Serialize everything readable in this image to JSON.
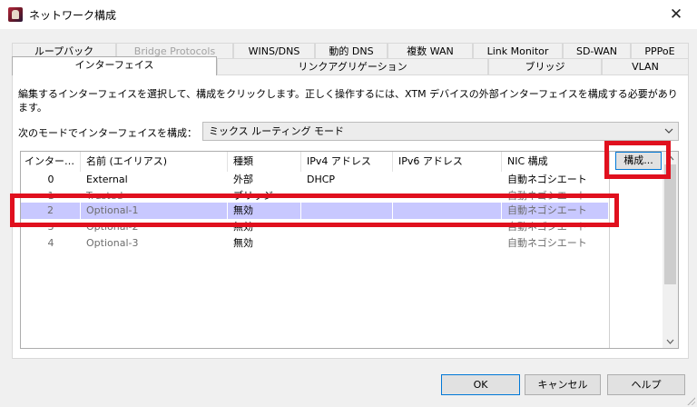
{
  "window": {
    "title": "ネットワーク構成",
    "close": "✕"
  },
  "tabs_row1": [
    {
      "label": "ループバック",
      "disabled": false
    },
    {
      "label": "Bridge Protocols",
      "disabled": true
    },
    {
      "label": "WINS/DNS",
      "disabled": false
    },
    {
      "label": "動的 DNS",
      "disabled": false
    },
    {
      "label": "複数 WAN",
      "disabled": false
    },
    {
      "label": "Link Monitor",
      "disabled": false
    },
    {
      "label": "SD-WAN",
      "disabled": false
    },
    {
      "label": "PPPoE",
      "disabled": false
    }
  ],
  "tabs_row2": [
    {
      "label": "インターフェイス",
      "active": true
    },
    {
      "label": "リンクアグリゲーション",
      "active": false
    },
    {
      "label": "ブリッジ",
      "active": false
    },
    {
      "label": "VLAN",
      "active": false
    }
  ],
  "description": "編集するインターフェイスを選択して、構成をクリックします。正しく操作するには、XTM デバイスの外部インターフェイスを構成する必要があります。",
  "mode": {
    "label": "次のモードでインターフェイスを構成：",
    "value": "ミックス ルーティング モード"
  },
  "table": {
    "columns": [
      "インター…",
      "名前 (エイリアス)",
      "種類",
      "IPv4 アドレス",
      "IPv6 アドレス",
      "NIC 構成"
    ],
    "rows": [
      {
        "index": "0",
        "name": "External",
        "type": "外部",
        "ipv4": "DHCP",
        "ipv6": "",
        "nic": "自動ネゴシエート",
        "selected": false,
        "dim": false
      },
      {
        "index": "1",
        "name": "Trusted",
        "type": "ブリッジ",
        "ipv4": "",
        "ipv6": "",
        "nic": "自動ネゴシエート",
        "selected": false,
        "dim": true
      },
      {
        "index": "2",
        "name": "Optional-1",
        "type": "無効",
        "ipv4": "",
        "ipv6": "",
        "nic": "自動ネゴシエート",
        "selected": true,
        "dim": true
      },
      {
        "index": "3",
        "name": "Optional-2",
        "type": "無効",
        "ipv4": "",
        "ipv6": "",
        "nic": "自動ネゴシエート",
        "selected": false,
        "dim": true
      },
      {
        "index": "4",
        "name": "Optional-3",
        "type": "無効",
        "ipv4": "",
        "ipv6": "",
        "nic": "自動ネゴシエート",
        "selected": false,
        "dim": true
      }
    ]
  },
  "buttons": {
    "configure": "構成...",
    "ok": "OK",
    "cancel": "キャンセル",
    "help": "ヘルプ"
  },
  "colors": {
    "highlight": "#e0101e",
    "selected_row": "#c8c8ff",
    "focus_border": "#0078d7"
  }
}
